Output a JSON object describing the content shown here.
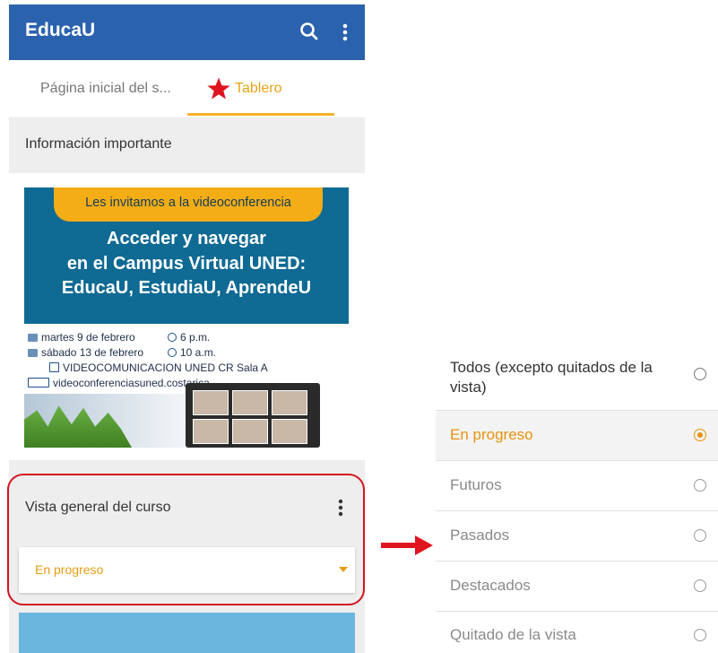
{
  "app": {
    "title": "EducaU",
    "search_icon": "search-icon",
    "menu_icon": "more-vert-icon"
  },
  "tabs": [
    {
      "label": "Página inicial del s..."
    },
    {
      "label": "Tablero",
      "icon": "star-icon"
    }
  ],
  "sections": {
    "info_title": "Información importante",
    "course_overview_title": "Vista general del curso"
  },
  "banner": {
    "pill": "Les invitamos a la videoconferencia",
    "headline1": "Acceder y navegar",
    "headline2": "en el Campus Virtual UNED:",
    "headline3": "EducaU, EstudiaU, AprendeU",
    "date1": "martes 9 de febrero",
    "time1": "6 p.m.",
    "date2": "sábado 13 de febrero",
    "time2": "10 a.m.",
    "channel": "VIDEOCOMUNICACION UNED CR Sala A",
    "live": "videoconferenciasuned.costarica"
  },
  "course_filter": {
    "selected": "En progreso"
  },
  "filter_options": [
    {
      "label": "Todos (excepto quitados de la vista)"
    },
    {
      "label": "En progreso",
      "selected": true
    },
    {
      "label": "Futuros"
    },
    {
      "label": "Pasados"
    },
    {
      "label": "Destacados"
    },
    {
      "label": "Quitado de la vista"
    }
  ],
  "colors": {
    "app_bar": "#2b62ae",
    "accent": "#e8920e",
    "highlight": "#d4141f",
    "star": "#e0141e"
  }
}
